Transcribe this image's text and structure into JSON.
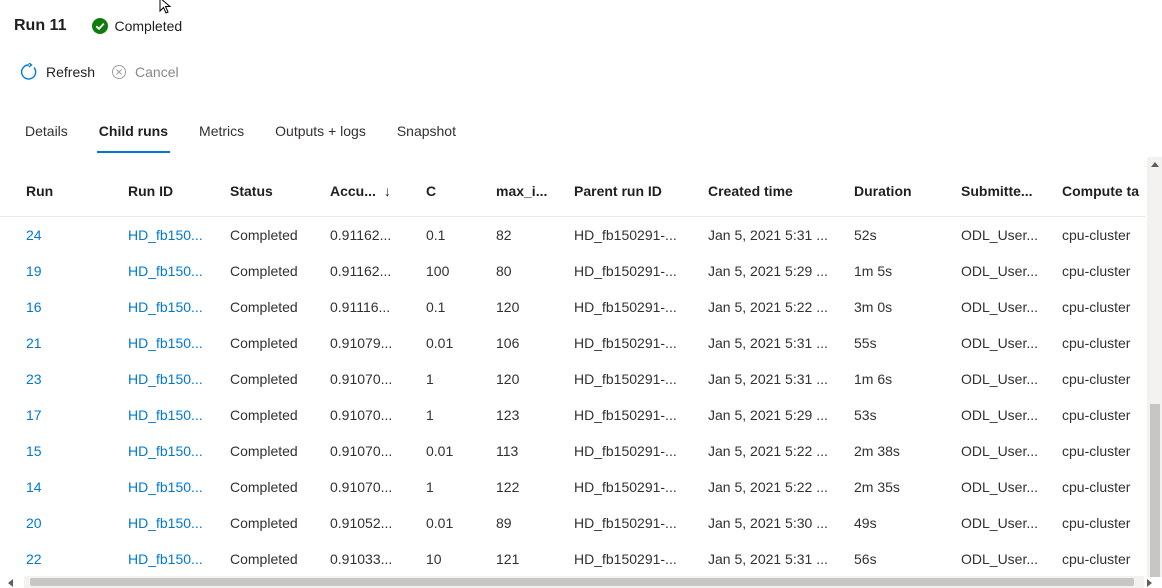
{
  "header": {
    "title": "Run 11",
    "status": "Completed",
    "status_color": "#107c10"
  },
  "toolbar": {
    "refresh_label": "Refresh",
    "cancel_label": "Cancel"
  },
  "tabs": [
    {
      "label": "Details"
    },
    {
      "label": "Child runs",
      "active": true
    },
    {
      "label": "Metrics"
    },
    {
      "label": "Outputs + logs"
    },
    {
      "label": "Snapshot"
    }
  ],
  "table": {
    "columns": [
      "Run",
      "Run ID",
      "Status",
      "Accu...",
      "C",
      "max_i...",
      "Parent run ID",
      "Created time",
      "Duration",
      "Submitte...",
      "Compute ta"
    ],
    "sort_indicator": "↓",
    "rows": [
      [
        "24",
        "HD_fb150...",
        "Completed",
        "0.91162...",
        "0.1",
        "82",
        "HD_fb150291-...",
        "Jan 5, 2021 5:31 ...",
        "52s",
        "ODL_User...",
        "cpu-cluster"
      ],
      [
        "19",
        "HD_fb150...",
        "Completed",
        "0.91162...",
        "100",
        "80",
        "HD_fb150291-...",
        "Jan 5, 2021 5:29 ...",
        "1m 5s",
        "ODL_User...",
        "cpu-cluster"
      ],
      [
        "16",
        "HD_fb150...",
        "Completed",
        "0.91116...",
        "0.1",
        "120",
        "HD_fb150291-...",
        "Jan 5, 2021 5:22 ...",
        "3m 0s",
        "ODL_User...",
        "cpu-cluster"
      ],
      [
        "21",
        "HD_fb150...",
        "Completed",
        "0.91079...",
        "0.01",
        "106",
        "HD_fb150291-...",
        "Jan 5, 2021 5:31 ...",
        "55s",
        "ODL_User...",
        "cpu-cluster"
      ],
      [
        "23",
        "HD_fb150...",
        "Completed",
        "0.91070...",
        "1",
        "120",
        "HD_fb150291-...",
        "Jan 5, 2021 5:31 ...",
        "1m 6s",
        "ODL_User...",
        "cpu-cluster"
      ],
      [
        "17",
        "HD_fb150...",
        "Completed",
        "0.91070...",
        "1",
        "123",
        "HD_fb150291-...",
        "Jan 5, 2021 5:29 ...",
        "53s",
        "ODL_User...",
        "cpu-cluster"
      ],
      [
        "15",
        "HD_fb150...",
        "Completed",
        "0.91070...",
        "0.01",
        "113",
        "HD_fb150291-...",
        "Jan 5, 2021 5:22 ...",
        "2m 38s",
        "ODL_User...",
        "cpu-cluster"
      ],
      [
        "14",
        "HD_fb150...",
        "Completed",
        "0.91070...",
        "1",
        "122",
        "HD_fb150291-...",
        "Jan 5, 2021 5:22 ...",
        "2m 35s",
        "ODL_User...",
        "cpu-cluster"
      ],
      [
        "20",
        "HD_fb150...",
        "Completed",
        "0.91052...",
        "0.01",
        "89",
        "HD_fb150291-...",
        "Jan 5, 2021 5:30 ...",
        "49s",
        "ODL_User...",
        "cpu-cluster"
      ],
      [
        "22",
        "HD_fb150...",
        "Completed",
        "0.91033...",
        "10",
        "121",
        "HD_fb150291-...",
        "Jan 5, 2021 5:31 ...",
        "56s",
        "ODL_User...",
        "cpu-cluster"
      ]
    ]
  }
}
